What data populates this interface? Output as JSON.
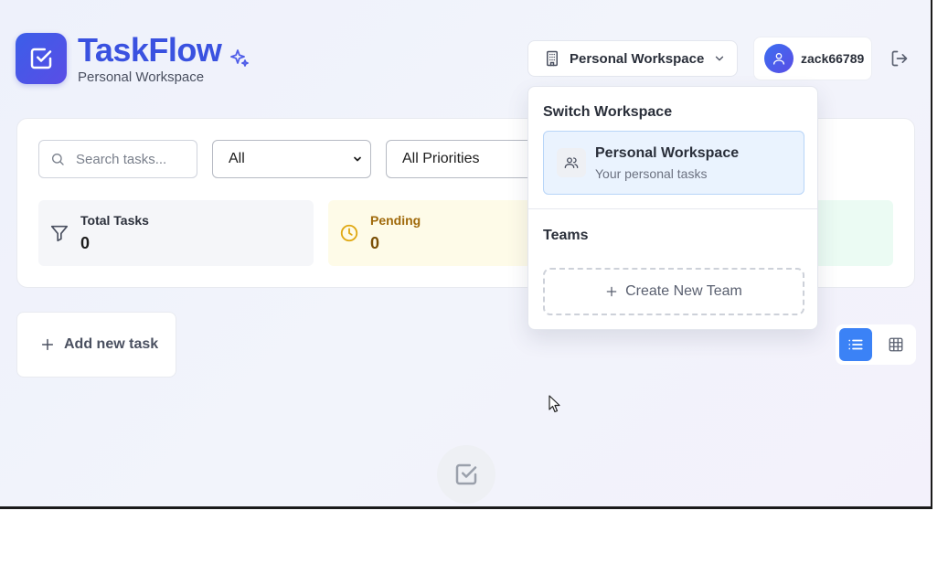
{
  "app": {
    "title": "TaskFlow",
    "subtitle": "Personal Workspace"
  },
  "header": {
    "workspace_button_label": "Personal Workspace",
    "username": "zack66789"
  },
  "filters": {
    "search_placeholder": "Search tasks...",
    "status_selected": "All",
    "priority_selected": "All Priorities"
  },
  "stats": {
    "total_label": "Total Tasks",
    "total_value": "0",
    "pending_label": "Pending",
    "pending_value": "0"
  },
  "main": {
    "add_task_label": "Add new task"
  },
  "workspace_menu": {
    "title": "Switch Workspace",
    "items": [
      {
        "name": "Personal Workspace",
        "description": "Your personal tasks"
      }
    ],
    "teams_label": "Teams",
    "create_team_label": "Create New Team"
  },
  "colors": {
    "brand": "#3a52e0",
    "view_active": "#3b82f6",
    "pending_bg": "#fefbe8",
    "completed_bg": "#ebfbf3"
  },
  "icons": {
    "logo": "check-square-icon",
    "sparkle": "sparkles-icon",
    "workspace": "building-icon",
    "user": "user-icon",
    "logout": "logout-icon",
    "search": "search-icon",
    "total": "filter-icon",
    "pending": "clock-icon",
    "team": "users-icon",
    "add": "plus-icon",
    "list_view": "list-icon",
    "grid_view": "grid-icon"
  }
}
